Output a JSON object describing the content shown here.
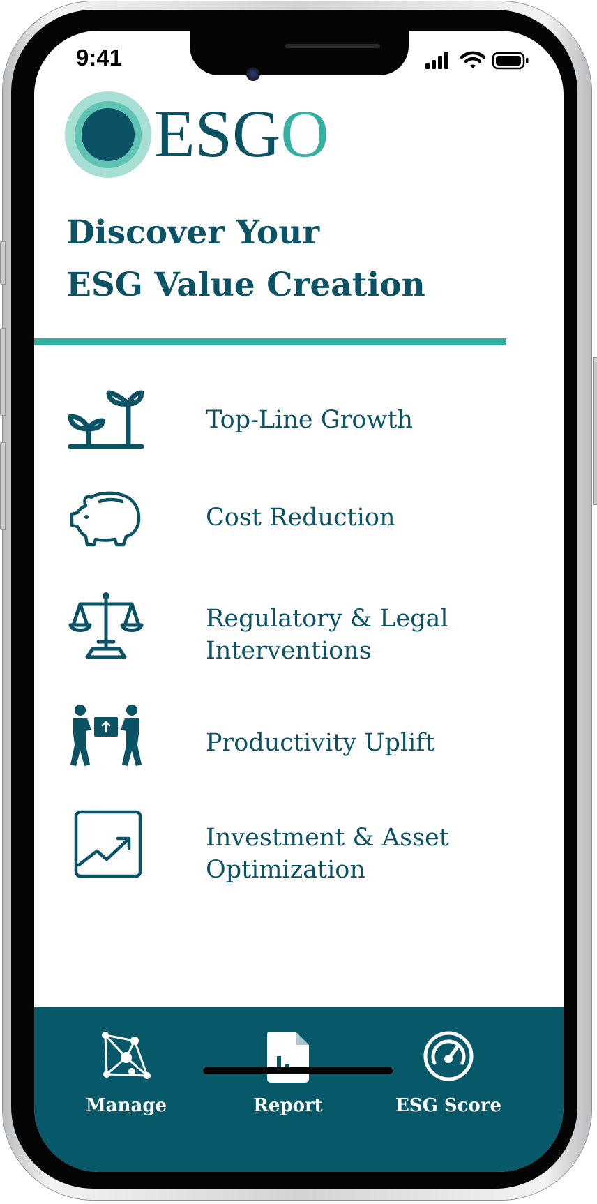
{
  "status_bar": {
    "time": "9:41"
  },
  "brand": {
    "name_prefix": "ESG",
    "name_suffix": "O"
  },
  "headline": {
    "line1": "Discover Your",
    "line2": "ESG Value Creation"
  },
  "value_drivers": [
    {
      "label_line1": "Top-Line Growth",
      "label_line2": "",
      "icon": "sprout-icon"
    },
    {
      "label_line1": "Cost Reduction",
      "label_line2": "",
      "icon": "piggy-bank-icon"
    },
    {
      "label_line1": "Regulatory & Legal",
      "label_line2": "Interventions",
      "icon": "scales-icon"
    },
    {
      "label_line1": "Productivity Uplift",
      "label_line2": "",
      "icon": "teamwork-icon"
    },
    {
      "label_line1": "Investment & Asset",
      "label_line2": "Optimization",
      "icon": "chart-growth-icon"
    }
  ],
  "tab_bar": {
    "tabs": [
      {
        "label": "Manage",
        "icon": "network-icon"
      },
      {
        "label": "Report",
        "icon": "report-document-icon"
      },
      {
        "label": "ESG Score",
        "icon": "gauge-icon"
      }
    ]
  },
  "colors": {
    "brand_dark": "#0a5264",
    "brand_accent": "#32b1a2",
    "tabbar_bg": "#07596a"
  }
}
